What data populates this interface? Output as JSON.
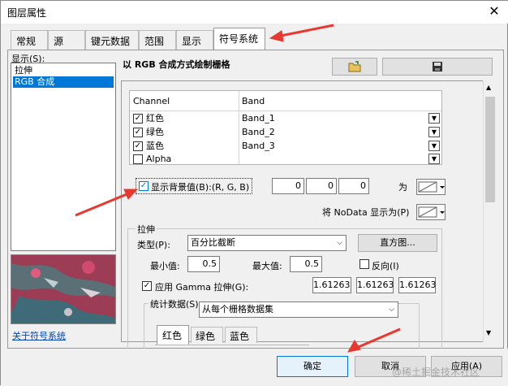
{
  "window": {
    "title": "图层属性",
    "close_glyph": "✕"
  },
  "tabs": [
    {
      "label": "常规"
    },
    {
      "label": "源"
    },
    {
      "label": "键元数据"
    },
    {
      "label": "范围"
    },
    {
      "label": "显示"
    },
    {
      "label": "符号系统"
    }
  ],
  "show_label": "显示(S):",
  "show_list": [
    {
      "label": "拉伸"
    },
    {
      "label": "RGB 合成"
    }
  ],
  "symbology_link": "关于符号系统",
  "section_title": "以 RGB 合成方式绘制栅格",
  "grid": {
    "headers": [
      "Channel",
      "Band"
    ],
    "rows": [
      {
        "channel": "红色",
        "band": "Band_1",
        "checked": true
      },
      {
        "channel": "绿色",
        "band": "Band_2",
        "checked": true
      },
      {
        "channel": "蓝色",
        "band": "Band_3",
        "checked": true
      },
      {
        "channel": "Alpha",
        "band": "",
        "checked": false
      }
    ]
  },
  "background": {
    "label": "显示背景值(B):(R, G, B)",
    "checked": true,
    "r": "0",
    "g": "0",
    "b": "0",
    "as_label": "为"
  },
  "nodata": {
    "label": "将 NoData 显示为(P)"
  },
  "stretch": {
    "group_label": "拉伸",
    "type_label": "类型(P):",
    "type_value": "百分比截断",
    "histogram_button": "直方图...",
    "min_label": "最小值:",
    "min_value": "0.5",
    "max_label": "最大值:",
    "max_value": "0.5",
    "invert_label": "反向(I)",
    "gamma_label": "应用 Gamma 拉伸(G):",
    "gamma_values": [
      "1.61263",
      "1.61263",
      "1.61263"
    ]
  },
  "stats": {
    "group_label": "统计数据(S)",
    "source_value": "从每个栅格数据集",
    "tabs": [
      "红色",
      "绿色",
      "蓝色"
    ]
  },
  "buttons": {
    "ok": "确定",
    "cancel": "取消",
    "apply": "应用(A)"
  },
  "watermark": "@稀土掘金技术社区",
  "colors": {
    "accent": "#0078d7",
    "arrow": "#e8382f"
  }
}
